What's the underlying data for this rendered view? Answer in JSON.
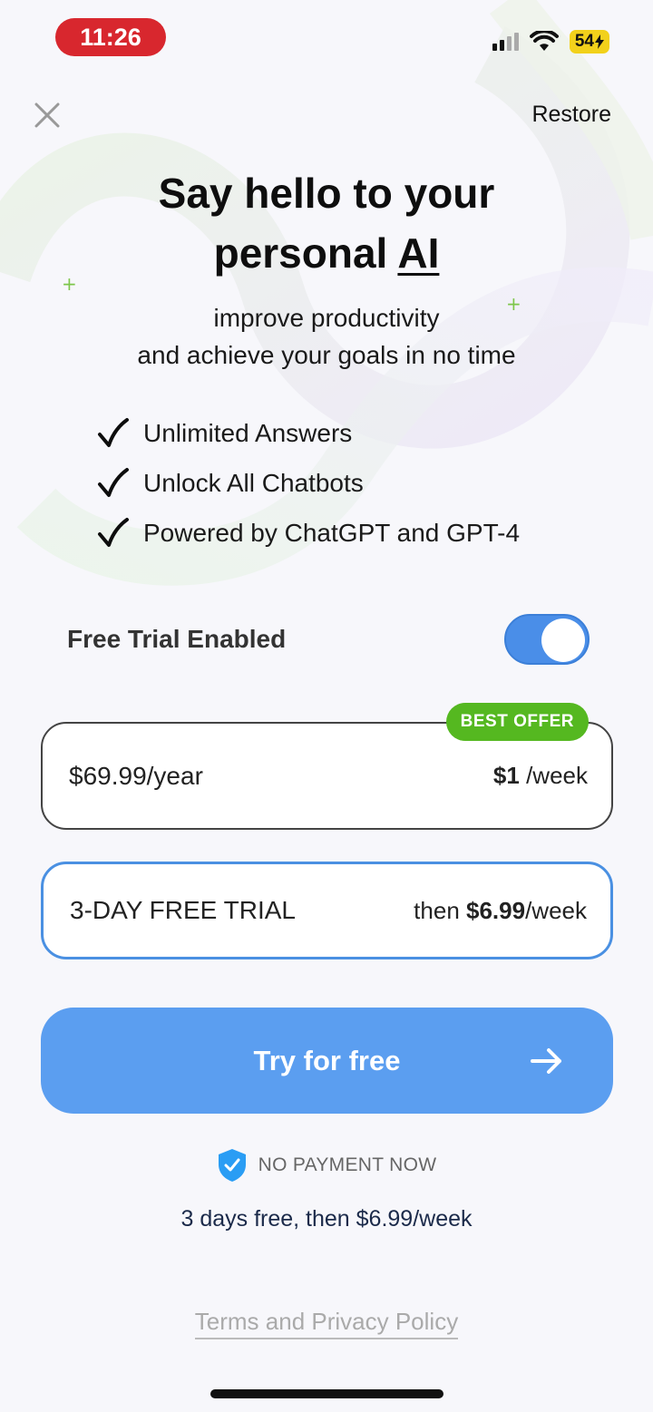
{
  "status_bar": {
    "time": "11:26",
    "battery": "54"
  },
  "header": {
    "close_icon": "close-icon",
    "restore_label": "Restore"
  },
  "hero": {
    "headline_line1": "Say hello to your",
    "headline_line2_prefix": "personal",
    "headline_line2_highlight": "AI",
    "subtitle_line1": "improve productivity",
    "subtitle_line2": "and achieve your goals in no time"
  },
  "features": [
    {
      "label": "Unlimited Answers",
      "icon": "checkmark-icon"
    },
    {
      "label": "Unlock All Chatbots",
      "icon": "checkmark-icon"
    },
    {
      "label": "Powered by ChatGPT and GPT-4",
      "icon": "checkmark-icon"
    }
  ],
  "free_trial": {
    "label": "Free Trial Enabled",
    "enabled": true
  },
  "plans": {
    "yearly": {
      "name": "$69.99/year",
      "price_bold": "$1",
      "price_suffix": " /week",
      "badge": "BEST OFFER"
    },
    "trial": {
      "name": "3-DAY FREE TRIAL",
      "price_prefix": "then ",
      "price_bold": "$6.99",
      "price_suffix": "/week",
      "selected": true
    }
  },
  "cta": {
    "label": "Try for free",
    "icon": "arrow-right-icon"
  },
  "notice": {
    "no_payment": "NO PAYMENT NOW",
    "fine_print": "3 days free, then $6.99/week"
  },
  "footer": {
    "terms_label": "Terms and Privacy Policy"
  },
  "colors": {
    "accent": "#5b9ef0",
    "badge": "#55b820",
    "time_pill": "#d8272e",
    "battery": "#f2d11b"
  }
}
